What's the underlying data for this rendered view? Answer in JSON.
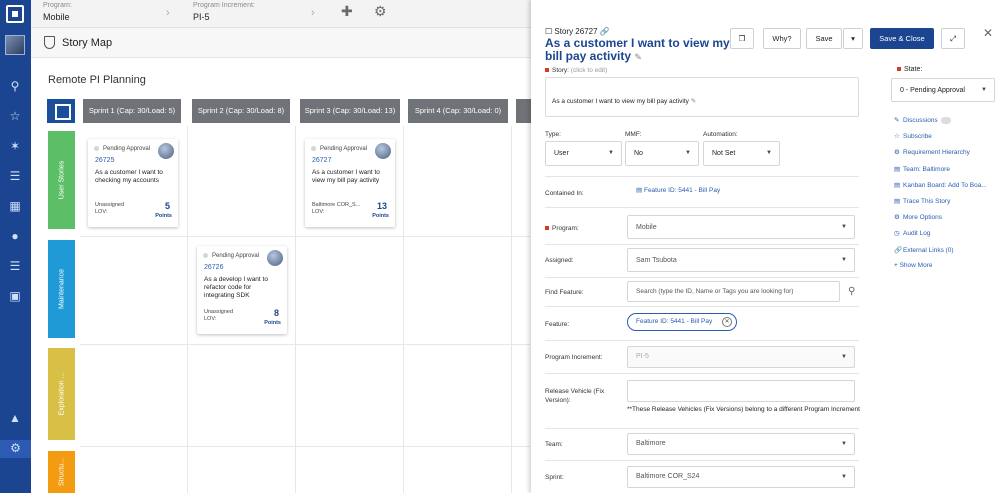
{
  "topbar": {
    "program_label": "Program:",
    "program_value": "Mobile",
    "pi_label": "Program Increment:",
    "pi_value": "PI-5"
  },
  "storymap": {
    "title": "Story Map",
    "planning_title": "Remote PI Planning",
    "sprints": [
      "Sprint 1 (Cap: 30/Load: 5)",
      "Sprint 2 (Cap: 30/Load: 8)",
      "Sprint 3 (Cap: 30/Load: 13)",
      "Sprint 4 (Cap: 30/Load: 0)"
    ],
    "lanes": [
      {
        "label": "User Stories",
        "color": "#5cbf67"
      },
      {
        "label": "Maintenance",
        "color": "#1f9ad7"
      },
      {
        "label": "Exploration ...",
        "color": "#d8c047"
      },
      {
        "label": "Structu...",
        "color": "#f39c12"
      }
    ],
    "cards": [
      {
        "status": "Pending Approval",
        "id": "26725",
        "desc": "As a customer I want to checking my accounts",
        "assign": "Unassigned",
        "lov": "LOV:",
        "points": "5",
        "points_label": "Points"
      },
      {
        "status": "Pending Approval",
        "id": "26726",
        "desc": "As a develop I want to refactor code for integrating SDK",
        "assign": "Unassigned",
        "lov": "LOV:",
        "points": "8",
        "points_label": "Points"
      },
      {
        "status": "Pending Approval",
        "id": "26727",
        "desc": "As a customer I want to view my bill pay activity",
        "assign": "Baltimore COR_S...",
        "lov": "LOV:",
        "points": "13",
        "points_label": "Points"
      }
    ]
  },
  "panel": {
    "story_ref": "Story 26727",
    "story_title": "As a customer I want to view my bill pay activity",
    "buttons": {
      "why": "Why?",
      "save": "Save",
      "save_close": "Save & Close"
    },
    "story_label": "Story:",
    "story_hint": "(click to edit)",
    "story_text": "As a customer I want to view my bill pay activity",
    "type_label": "Type:",
    "type_value": "User",
    "mmf_label": "MMF:",
    "mmf_value": "No",
    "automation_label": "Automation:",
    "automation_value": "Not Set",
    "contained_label": "Contained In:",
    "contained_value": "Feature ID: 5441 - Bill Pay",
    "program_label": "Program:",
    "program_value": "Mobile",
    "assigned_label": "Assigned:",
    "assigned_value": "Sam Tsubota",
    "find_label": "Find Feature:",
    "find_placeholder": "Search (type the ID, Name or Tags you are looking for)",
    "feature_label": "Feature:",
    "feature_tag": "Feature ID: 5441 - Bill Pay",
    "pi_label": "Program Increment:",
    "pi_value": "PI-5",
    "release_label": "Release Vehicle (Fix Version):",
    "release_note": "**These Release Vehicles (Fix Versions) belong to a different Program Increment",
    "team_label": "Team:",
    "team_value": "Baltimore",
    "sprint_label": "Sprint:",
    "sprint_value": "Baltimore COR_S24",
    "state_label": "State:",
    "state_value": "0 - Pending Approval",
    "side_links": [
      "Discussions",
      "Subscribe",
      "Requirement Hierarchy",
      "Team: Baltimore",
      "Kanban Board: Add To Boa...",
      "Trace This Story",
      "More Options",
      "Audit Log",
      "External Links (0)",
      "+ Show More"
    ]
  }
}
